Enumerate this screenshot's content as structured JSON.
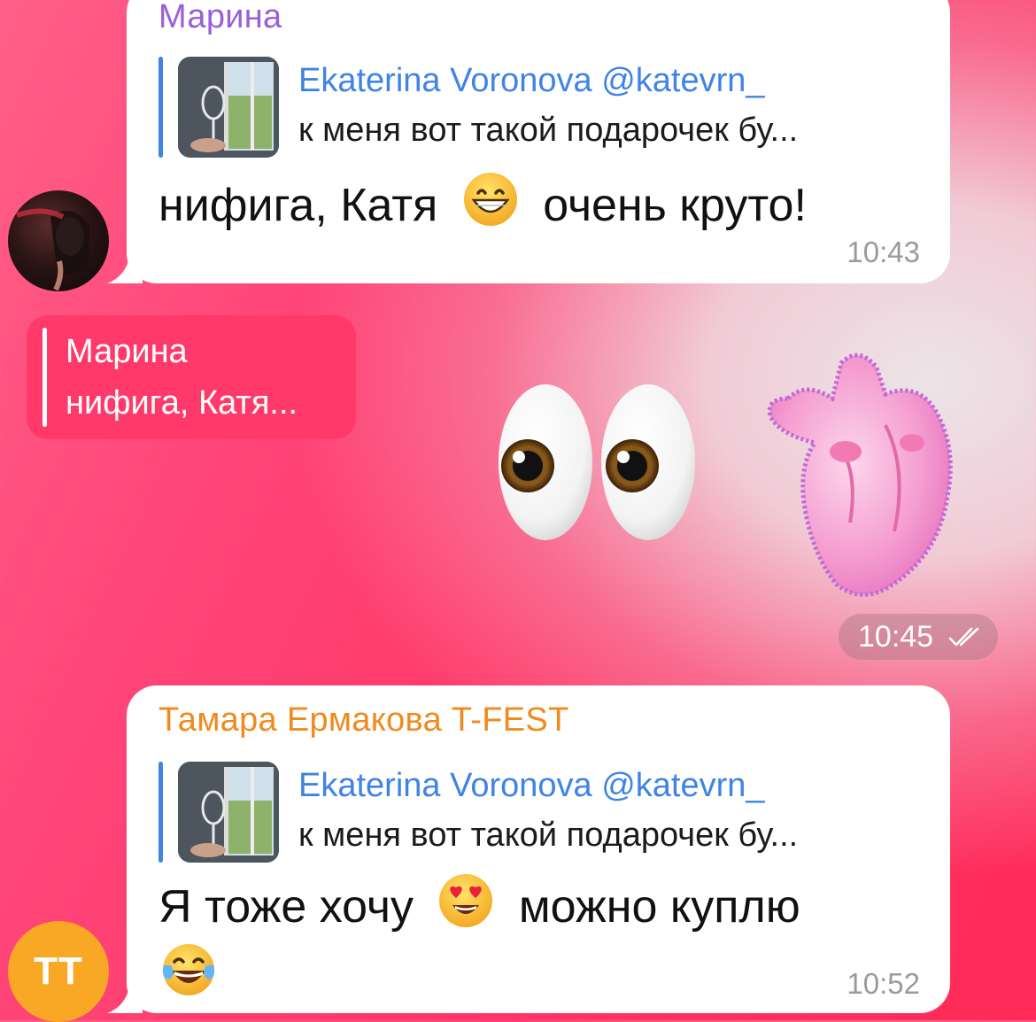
{
  "messages": [
    {
      "sender": "Марина",
      "reply": {
        "author": "Ekaterina Voronova @katevrn_",
        "text": "к меня вот такой подарочек бу..."
      },
      "text_before": "нифига, Катя",
      "emoji": "grinning-face",
      "text_after": "очень круто!",
      "time": "10:43"
    },
    {
      "reply_chip": {
        "author": "Марина",
        "text": "нифига, Катя..."
      },
      "stickers": [
        "eyes-emoji",
        "anatomical-heart-sticker"
      ],
      "time": "10:45",
      "status": "read-double-check"
    },
    {
      "sender": "Тамара Ермакова T-FEST",
      "avatar_initials": "ТТ",
      "reply": {
        "author": "Ekaterina Voronova @katevrn_",
        "text": "к меня вот такой подарочек бу..."
      },
      "text_before": "Я тоже хочу",
      "emoji": "heart-eyes-face",
      "text_after": "можно куплю",
      "emoji_line2": "tears-of-joy-face",
      "time": "10:52"
    }
  ],
  "colors": {
    "sender1": "#9a5fd6",
    "sender2": "#f08a1d",
    "reply_accent": "#3f84e5",
    "avatar_tt": "#f9a825",
    "reply_chip_bg": "#ff3a6a"
  }
}
